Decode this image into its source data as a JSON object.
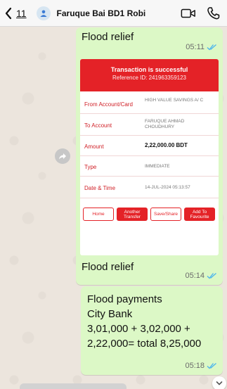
{
  "header": {
    "back_count": "11",
    "contact_name": "Faruque Bai BD1 Robi",
    "icons": [
      "chevron-left-icon",
      "person-icon",
      "video-call-icon",
      "phone-icon"
    ]
  },
  "messages": [
    {
      "text": "Flood relief",
      "time": "05:11"
    },
    {
      "text": "Flood relief",
      "time": "05:14"
    },
    {
      "lines": [
        "Flood payments",
        "City Bank",
        "3,01,000 + 3,02,000 +",
        "2,22,000= total 8,25,000"
      ],
      "time": "05:18"
    }
  ],
  "receipt": {
    "title": "Transaction is successful",
    "reference": "Reference ID: 241963359123",
    "rows": [
      {
        "label": "From Account/Card",
        "value": "HIGH VALUE SAVINGS A/ C"
      },
      {
        "label": "To Account",
        "value": "FARUQUE AHMAD CHOUDHURY"
      },
      {
        "label": "Amount",
        "value": "2,22,000.00  BDT"
      },
      {
        "label": "Type",
        "value": "IMMEDIATE"
      },
      {
        "label": "Date & Time",
        "value": "14-JUL-2024 05:13:57"
      }
    ],
    "buttons": [
      "Home",
      "Another Transfer",
      "Save/Share",
      "Add To Favourite"
    ]
  },
  "colors": {
    "bubble": "#dcf8c6",
    "receipt_accent": "#e42227",
    "ticks": "#4fb6ec",
    "chat_background": "#ece5dd"
  }
}
